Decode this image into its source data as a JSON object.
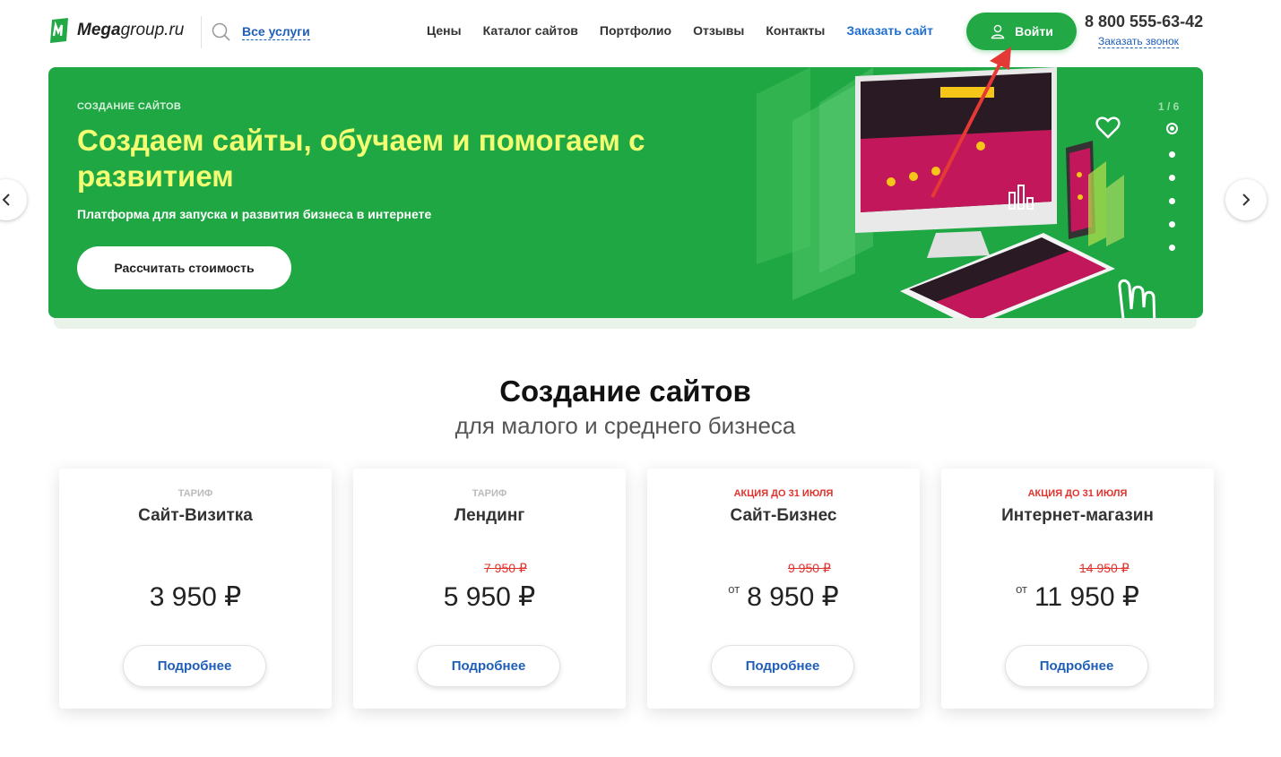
{
  "header": {
    "logo_bold": "Mega",
    "logo_rest": "group.ru",
    "services_link": "Все услуги",
    "nav": [
      "Цены",
      "Каталог сайтов",
      "Портфолио",
      "Отзывы",
      "Контакты",
      "Заказать сайт"
    ],
    "login_label": "Войти",
    "phone": "8 800 555-63-42",
    "callback_link": "Заказать звонок"
  },
  "banner": {
    "kicker": "Создание сайтов",
    "title": "Создаем сайты, обучаем и помогаем с развитием",
    "subtitle": "Платформа для запуска и развития бизнеса в интернете",
    "cta": "Рассчитать стоимость",
    "slide_counter": "1 / 6",
    "slides_total": 6,
    "active_slide": 1
  },
  "section": {
    "title": "Создание сайтов",
    "subtitle": "для малого и среднего бизнеса"
  },
  "cards": [
    {
      "tag": "Тариф",
      "promo": false,
      "name": "Сайт-Визитка",
      "old_price": "",
      "from": "",
      "price": "3 950 ₽",
      "button": "Подробнее"
    },
    {
      "tag": "Тариф",
      "promo": false,
      "name": "Лендинг",
      "old_price": "7 950 ₽",
      "from": "",
      "price": "5 950 ₽",
      "button": "Подробнее"
    },
    {
      "tag": "Акция до 31 июля",
      "promo": true,
      "name": "Сайт-Бизнес",
      "old_price": "9 950 ₽",
      "from": "от",
      "price": "8 950 ₽",
      "button": "Подробнее"
    },
    {
      "tag": "Акция до 31 июля",
      "promo": true,
      "name": "Интернет-магазин",
      "old_price": "14 950 ₽",
      "from": "от",
      "price": "11 950 ₽",
      "button": "Подробнее"
    }
  ],
  "colors": {
    "brand_green": "#1fa744",
    "title_yellow": "#f3ff72",
    "link_blue": "#1f5fb8",
    "promo_red": "#e0332d"
  }
}
